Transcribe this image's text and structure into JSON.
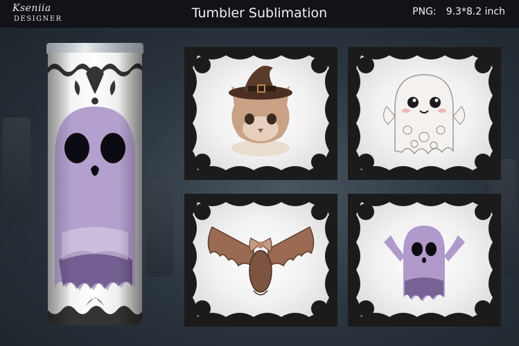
{
  "header": {
    "logo_name": "Kseniia",
    "logo_sub": "DESIGNER",
    "title": "Tumbler Sublimation",
    "format_label": "PNG:",
    "size_label": "9.3*8.2 inch"
  },
  "colors": {
    "header_bg": "#111316",
    "lace": "#1a1a1a",
    "ghost_purple": "#b09acb",
    "bat_brown": "#9a6b52"
  },
  "panels": [
    {
      "subject": "cat-with-witch-hat"
    },
    {
      "subject": "white-lace-ghost"
    },
    {
      "subject": "lace-bat-with-bow"
    },
    {
      "subject": "purple-ghost"
    }
  ],
  "tumbler": {
    "subject": "purple-ghost-tumbler"
  }
}
